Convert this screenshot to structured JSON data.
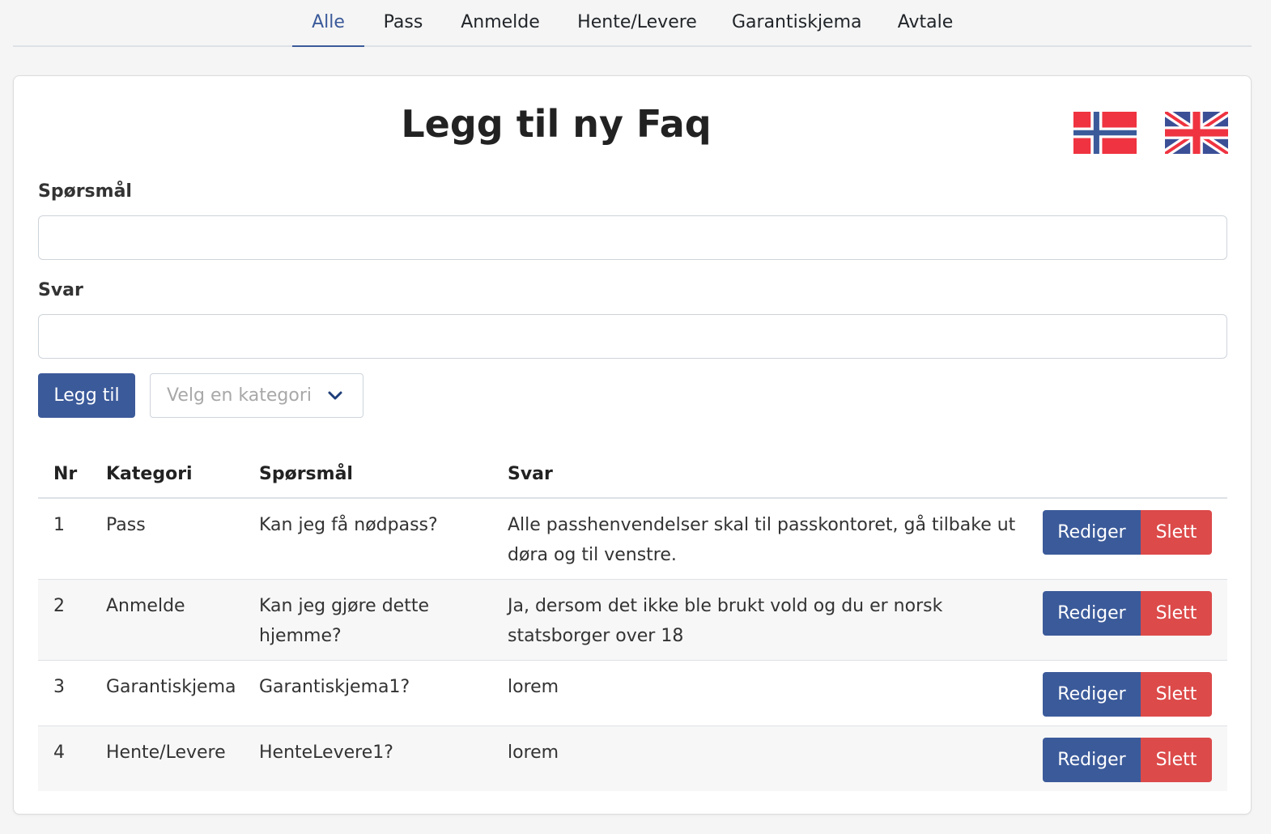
{
  "nav": {
    "tabs": [
      {
        "label": "Alle",
        "active": true
      },
      {
        "label": "Pass",
        "active": false
      },
      {
        "label": "Anmelde",
        "active": false
      },
      {
        "label": "Hente/Levere",
        "active": false
      },
      {
        "label": "Garantiskjema",
        "active": false
      },
      {
        "label": "Avtale",
        "active": false
      }
    ]
  },
  "form": {
    "title": "Legg til ny Faq",
    "question_label": "Spørsmål",
    "question_value": "",
    "answer_label": "Svar",
    "answer_value": "",
    "add_button": "Legg til",
    "category_placeholder": "Velg en kategori"
  },
  "languages": [
    {
      "name": "norwegian-flag-icon"
    },
    {
      "name": "uk-flag-icon"
    }
  ],
  "table": {
    "headers": {
      "nr": "Nr",
      "category": "Kategori",
      "question": "Spørsmål",
      "answer": "Svar"
    },
    "edit_label": "Rediger",
    "delete_label": "Slett",
    "rows": [
      {
        "nr": "1",
        "category": "Pass",
        "question": "Kan jeg få nødpass?",
        "answer": "Alle passhenvendelser skal til passkontoret, gå tilbake ut døra og til venstre."
      },
      {
        "nr": "2",
        "category": "Anmelde",
        "question": "Kan jeg gjøre dette hjemme?",
        "answer": "Ja, dersom det ikke ble brukt vold og du er norsk statsborger over 18"
      },
      {
        "nr": "3",
        "category": "Garantiskjema",
        "question": "Garantiskjema1?",
        "answer": "lorem"
      },
      {
        "nr": "4",
        "category": "Hente/Levere",
        "question": "HenteLevere1?",
        "answer": "lorem"
      }
    ]
  },
  "colors": {
    "primary": "#3b5a9a",
    "danger": "#dc4a4a",
    "background": "#f5f5f5"
  }
}
